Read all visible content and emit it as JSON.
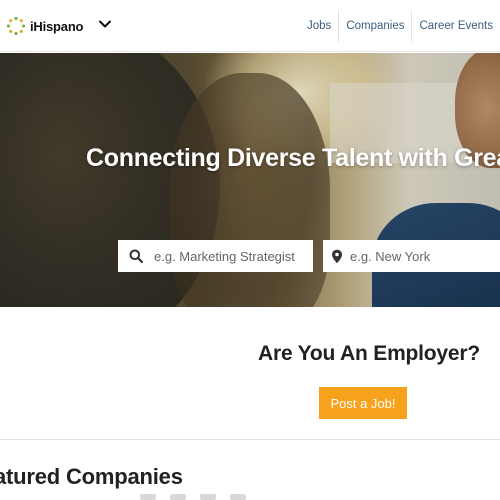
{
  "header": {
    "logo_text": "iHispano",
    "nav": [
      {
        "label": "Jobs"
      },
      {
        "label": "Companies"
      },
      {
        "label": "Career Events"
      }
    ]
  },
  "hero": {
    "title": "Connecting Diverse Talent with Great C",
    "keyword_placeholder": "e.g. Marketing Strategist",
    "location_placeholder": "e.g. New York"
  },
  "employer": {
    "title": "Are You An Employer?",
    "cta_label": "Post a Job!"
  },
  "featured": {
    "title": "atured Companies"
  },
  "icons": {
    "logo": "ihispano-logo-icon",
    "menu": "chevron-down-icon",
    "keyword": "search-icon",
    "location": "map-pin-icon"
  },
  "colors": {
    "accent": "#f7a21d",
    "nav_link": "#3d5d7d",
    "logo_green": "#7cb342",
    "logo_gold": "#e0b030"
  }
}
